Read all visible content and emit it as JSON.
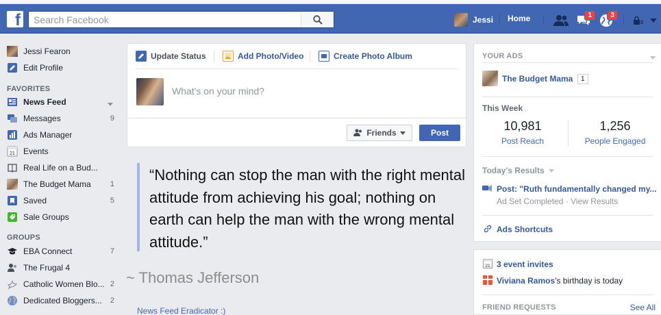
{
  "topbar": {
    "search_placeholder": "Search Facebook",
    "user_name": "Jessi",
    "home_label": "Home",
    "friend_requests_count": "",
    "messages_count": "1",
    "notifications_count": "3",
    "accent": "#4267b2"
  },
  "sidebar": {
    "profile_name": "Jessi Fearon",
    "edit_profile": "Edit Profile",
    "favorites_heading": "FAVORITES",
    "favorites": [
      {
        "label": "News Feed",
        "count": "",
        "icon": "news-feed-icon"
      },
      {
        "label": "Messages",
        "count": "9",
        "icon": "messages-icon"
      },
      {
        "label": "Ads Manager",
        "count": "",
        "icon": "ads-manager-icon"
      },
      {
        "label": "Events",
        "count": "",
        "icon": "events-icon"
      },
      {
        "label": "Real Life on a Bud...",
        "count": "",
        "icon": "page-icon"
      },
      {
        "label": "The Budget Mama",
        "count": "1",
        "icon": "page-avatar-icon"
      },
      {
        "label": "Saved",
        "count": "5",
        "icon": "saved-icon"
      },
      {
        "label": "Sale Groups",
        "count": "",
        "icon": "sale-groups-icon"
      }
    ],
    "groups_heading": "GROUPS",
    "groups": [
      {
        "label": "EBA Connect",
        "count": "7",
        "icon": "graduation-cap-icon"
      },
      {
        "label": "The Frugal 4",
        "count": "",
        "icon": "group-icon"
      },
      {
        "label": "Catholic Women Blo...",
        "count": "2",
        "icon": "dove-icon"
      },
      {
        "label": "Dedicated Bloggers...",
        "count": "2",
        "icon": "globe-icon"
      }
    ]
  },
  "composer": {
    "tab_update": "Update Status",
    "tab_photo": "Add Photo/Video",
    "tab_album": "Create Photo Album",
    "placeholder": "What's on your mind?",
    "audience": "Friends",
    "post": "Post"
  },
  "feed": {
    "quote": "“Nothing can stop the man with the right mental attitude from achieving his goal; nothing on earth can help the man with the wrong mental attitude.”",
    "author": "~ Thomas Jefferson",
    "eradicator": "News Feed Eradicator :)"
  },
  "ads": {
    "heading": "YOUR ADS",
    "page_name": "The Budget Mama",
    "page_badge": "1",
    "this_week": "This Week",
    "reach_value": "10,981",
    "reach_label": "Post Reach",
    "engaged_value": "1,256",
    "engaged_label": "People Engaged",
    "todays_results": "Today's Results",
    "post_title": "Post: \"Ruth fundamentally changed my...",
    "ad_status": "Ad Set Completed",
    "view_results": "View Results",
    "shortcuts": "Ads Shortcuts"
  },
  "events": {
    "invites": "3 event invites",
    "birthday_name": "Viviana Ramos",
    "birthday_suffix": "'s birthday is today",
    "friend_requests": "FRIEND REQUESTS",
    "see_all": "See All"
  }
}
